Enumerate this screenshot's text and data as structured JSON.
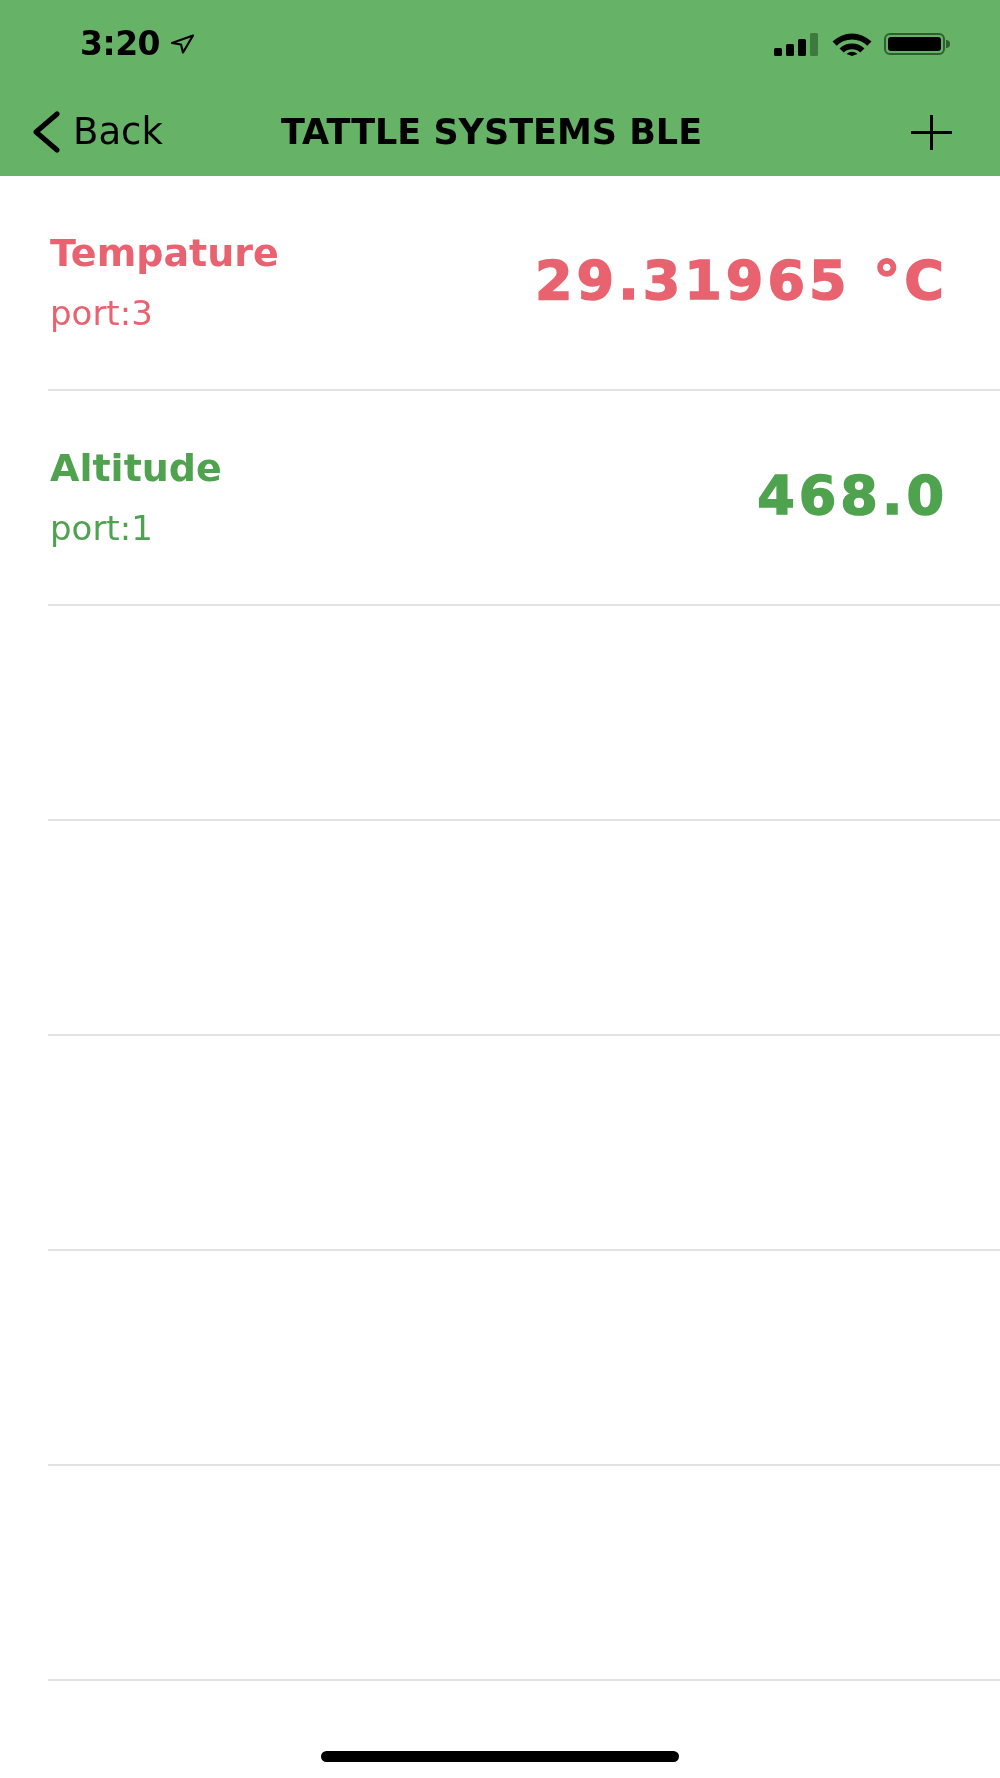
{
  "status_bar": {
    "time": "3:20"
  },
  "nav_bar": {
    "back_label": "Back",
    "title": "TATTLE SYSTEMS BLE"
  },
  "sensors": [
    {
      "name": "Tempature",
      "port": "port:3",
      "value": "29.31965 °C",
      "color": "#e8636f"
    },
    {
      "name": "Altitude",
      "port": "port:1",
      "value": "468.0",
      "color": "#4fa34f"
    }
  ]
}
